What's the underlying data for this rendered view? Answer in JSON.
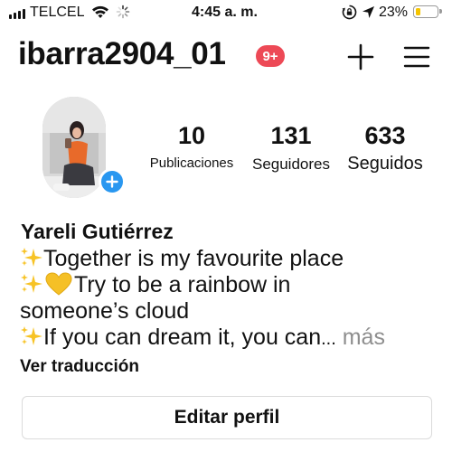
{
  "status_bar": {
    "carrier": "TELCEL",
    "time": "4:45 a. m.",
    "battery_percent": "23%",
    "battery_level": 0.23,
    "icons": [
      "signal-icon",
      "wifi-icon",
      "activity-spinner-icon",
      "orientation-lock-icon",
      "location-arrow-icon",
      "battery-icon"
    ]
  },
  "profile": {
    "username": "ibarra2904_01",
    "notifications_badge": "9+",
    "full_name": "Yareli Gutiérrez",
    "stats": {
      "posts": {
        "value": "10",
        "label": "Publicaciones"
      },
      "followers": {
        "value": "131",
        "label": "Seguidores"
      },
      "following": {
        "value": "633",
        "label": "Seguidos"
      }
    },
    "bio": {
      "line1": "Together is my favourite place",
      "line2": "Try to be a rainbow in",
      "line3": "someone’s cloud",
      "line4": "If you can dream it, you can",
      "line4_ellipsis": "...",
      "more": " más"
    },
    "translate_label": "Ver traducción",
    "edit_profile_label": "Editar perfil"
  },
  "colors": {
    "badge_red": "#ed4956",
    "add_blue": "#2997f0",
    "battery_yellow": "#f5c400",
    "muted_gray": "#8e8e8e",
    "sparkle_yellow": "#f7c325",
    "heart_yellow": "#f5c026"
  }
}
